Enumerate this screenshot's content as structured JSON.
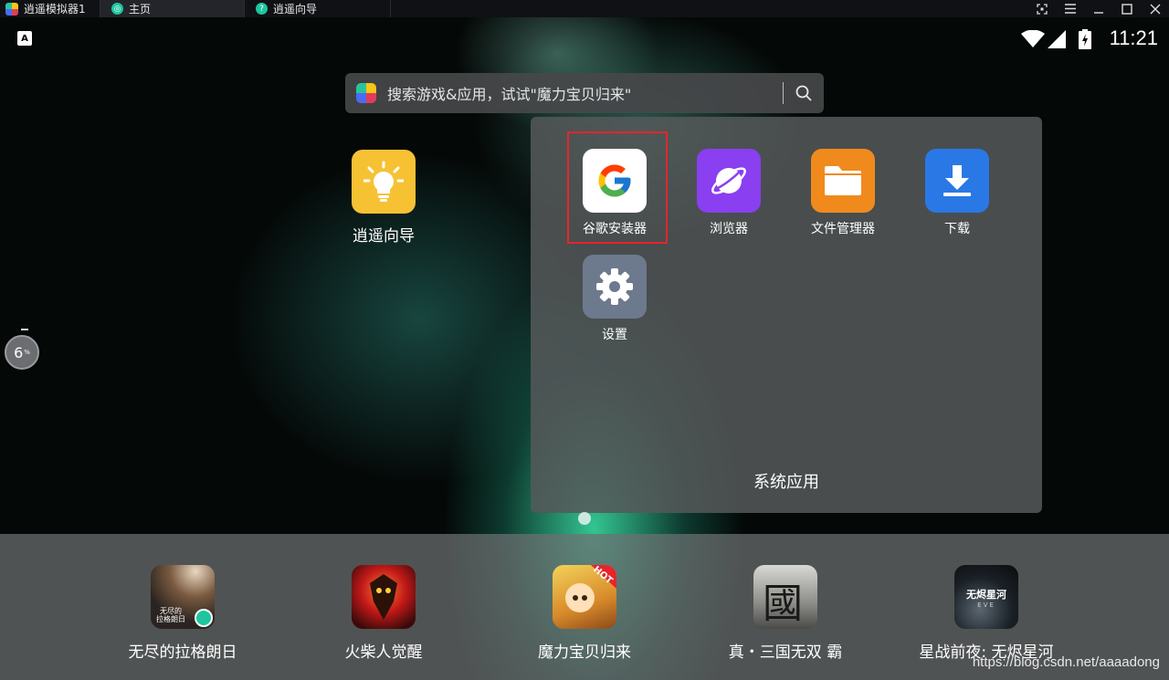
{
  "window": {
    "app_title": "逍遥模拟器1",
    "tabs": [
      {
        "label": "主页"
      },
      {
        "label": "逍遥向导"
      }
    ],
    "controls": [
      "expand-icon",
      "menu-icon",
      "minimize-icon",
      "maximize-icon",
      "close-icon"
    ]
  },
  "status": {
    "time": "11:21",
    "notification_letter": "A"
  },
  "search": {
    "placeholder": "搜索游戏&应用，试试\"魔力宝贝归来\""
  },
  "desktop_apps": [
    {
      "label": "逍遥向导",
      "icon": "lightbulb-icon",
      "color": "#f6c234"
    }
  ],
  "badge": {
    "value": "6",
    "unit": "%"
  },
  "folder": {
    "title": "系统应用",
    "apps": [
      {
        "label": "谷歌安装器",
        "icon": "google-icon",
        "color": "#ffffff",
        "highlighted": true
      },
      {
        "label": "浏览器",
        "icon": "planet-icon",
        "color": "#8a3ff0"
      },
      {
        "label": "文件管理器",
        "icon": "folder-icon",
        "color": "#f08a1c"
      },
      {
        "label": "下载",
        "icon": "download-icon",
        "color": "#2a78e6"
      },
      {
        "label": "设置",
        "icon": "gear-icon",
        "color": "#6d7a8e"
      }
    ]
  },
  "dock": {
    "apps": [
      {
        "label": "无尽的拉格朗日",
        "icon_text": "无尽的\n拉格朗日"
      },
      {
        "label": "火柴人觉醒"
      },
      {
        "label": "魔力宝贝归来",
        "icon_text": "HOT"
      },
      {
        "label": "真・三国无双 霸",
        "icon_text": "國"
      },
      {
        "label": "星战前夜: 无烬星河",
        "icon_text": "无烬星河",
        "icon_subtext": "EVE"
      }
    ]
  },
  "watermark": "https://blog.csdn.net/aaaadong"
}
